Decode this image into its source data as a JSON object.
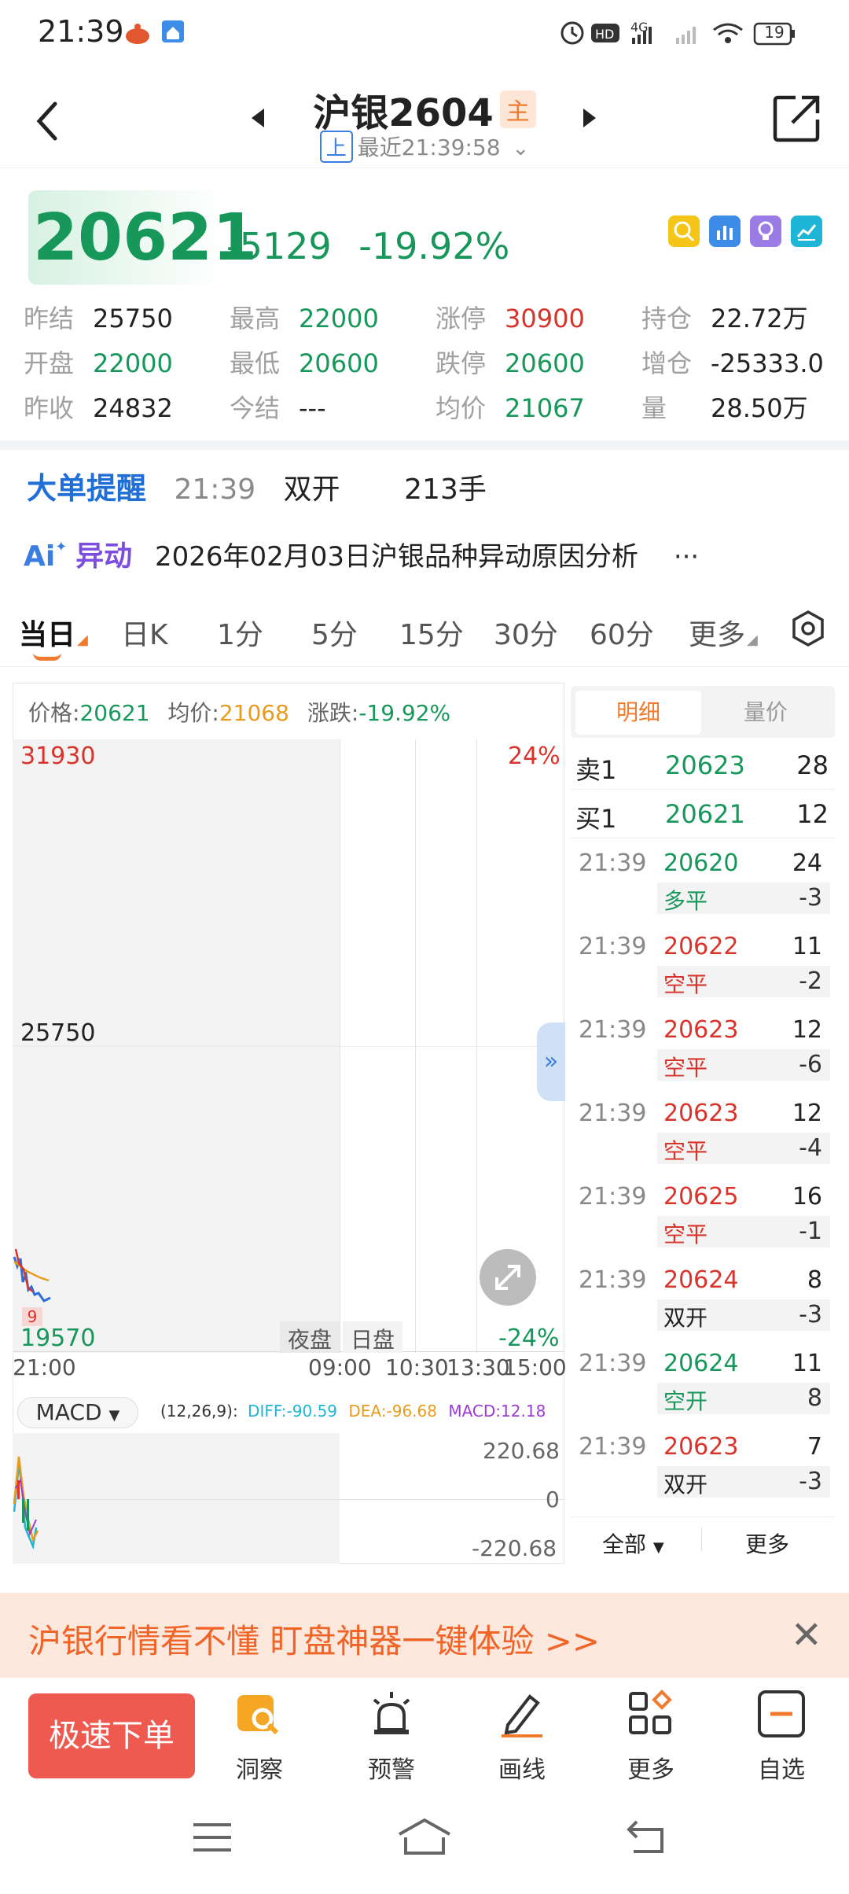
{
  "status_bar": {
    "time": "21:39",
    "battery": "19"
  },
  "header": {
    "title": "沪银2604",
    "main_badge": "主",
    "exchange": "上",
    "latest": "最近21:39:58"
  },
  "quote": {
    "price": "20621",
    "change": "-5129",
    "change_pct": "-19.92%"
  },
  "stats": [
    [
      {
        "label": "昨结",
        "value": "25750",
        "color": "dark"
      },
      {
        "label": "最高",
        "value": "22000",
        "color": "green"
      },
      {
        "label": "涨停",
        "value": "30900",
        "color": "red"
      },
      {
        "label": "持仓",
        "value": "22.72万",
        "color": "dark"
      }
    ],
    [
      {
        "label": "开盘",
        "value": "22000",
        "color": "green"
      },
      {
        "label": "最低",
        "value": "20600",
        "color": "green"
      },
      {
        "label": "跌停",
        "value": "20600",
        "color": "green"
      },
      {
        "label": "增仓",
        "value": "-25333.0",
        "color": "dark"
      }
    ],
    [
      {
        "label": "昨收",
        "value": "24832",
        "color": "dark"
      },
      {
        "label": "今结",
        "value": "---",
        "color": "dark"
      },
      {
        "label": "均价",
        "value": "21067",
        "color": "green"
      },
      {
        "label": "量",
        "value": "28.50万",
        "color": "dark"
      }
    ]
  ],
  "big_order": {
    "title": "大单提醒",
    "time": "21:39",
    "type": "双开",
    "lots": "213手"
  },
  "anomaly": {
    "badge_ai": "Ai",
    "badge_text": "异动",
    "text": "2026年02月03日沪银品种异动原因分析",
    "more": "···"
  },
  "tabs": [
    "当日",
    "日K",
    "1分",
    "5分",
    "15分",
    "30分",
    "60分",
    "更多"
  ],
  "chart": {
    "info_price_label": "价格:",
    "info_price": "20621",
    "info_avg_label": "均价:",
    "info_avg": "21068",
    "info_chg_label": "涨跌:",
    "info_chg": "-19.92%",
    "y_top": "31930",
    "y_mid": "25750",
    "y_bottom": "19570",
    "pct_top": "24%",
    "pct_bottom": "-24%",
    "session_night": "夜盘",
    "session_day": "日盘",
    "marker": "9",
    "times": [
      "21:00",
      "09:00",
      "10:30",
      "13:30",
      "15:00"
    ]
  },
  "macd": {
    "button": "MACD",
    "params": "(12,26,9):",
    "diff_label": "DIFF:",
    "diff": "-90.59",
    "dea_label": "DEA:",
    "dea": "-96.68",
    "macd_label": "MACD:",
    "macd": "12.18",
    "y_top": "220.68",
    "y_mid": "0",
    "y_bottom": "-220.68"
  },
  "panel": {
    "tab_detail": "明细",
    "tab_volume_price": "量价",
    "ask": {
      "label": "卖1",
      "price": "20623",
      "qty": "28"
    },
    "bid": {
      "label": "买1",
      "price": "20621",
      "qty": "12"
    },
    "trades": [
      {
        "time": "21:39",
        "price": "20620",
        "price_color": "green",
        "qty": "24",
        "kind": "多平",
        "kind_color": "green",
        "oi": "-3"
      },
      {
        "time": "21:39",
        "price": "20622",
        "price_color": "red",
        "qty": "11",
        "kind": "空平",
        "kind_color": "red",
        "oi": "-2"
      },
      {
        "time": "21:39",
        "price": "20623",
        "price_color": "red",
        "qty": "12",
        "kind": "空平",
        "kind_color": "red",
        "oi": "-6"
      },
      {
        "time": "21:39",
        "price": "20623",
        "price_color": "red",
        "qty": "12",
        "kind": "空平",
        "kind_color": "red",
        "oi": "-4"
      },
      {
        "time": "21:39",
        "price": "20625",
        "price_color": "red",
        "qty": "16",
        "kind": "空平",
        "kind_color": "red",
        "oi": "-1"
      },
      {
        "time": "21:39",
        "price": "20624",
        "price_color": "red",
        "qty": "8",
        "kind": "双开",
        "kind_color": "dark",
        "oi": "-3"
      },
      {
        "time": "21:39",
        "price": "20624",
        "price_color": "green",
        "qty": "11",
        "kind": "空开",
        "kind_color": "green",
        "oi": "8"
      },
      {
        "time": "21:39",
        "price": "20623",
        "price_color": "red",
        "qty": "7",
        "kind": "双开",
        "kind_color": "dark",
        "oi": "-3"
      }
    ],
    "footer_all": "全部",
    "footer_more": "更多"
  },
  "banner": {
    "text": "沪银行情看不懂  盯盘神器一键体验 >>"
  },
  "toolbar": {
    "order": "极速下单",
    "items": [
      "洞察",
      "预警",
      "画线",
      "更多",
      "自选"
    ]
  }
}
